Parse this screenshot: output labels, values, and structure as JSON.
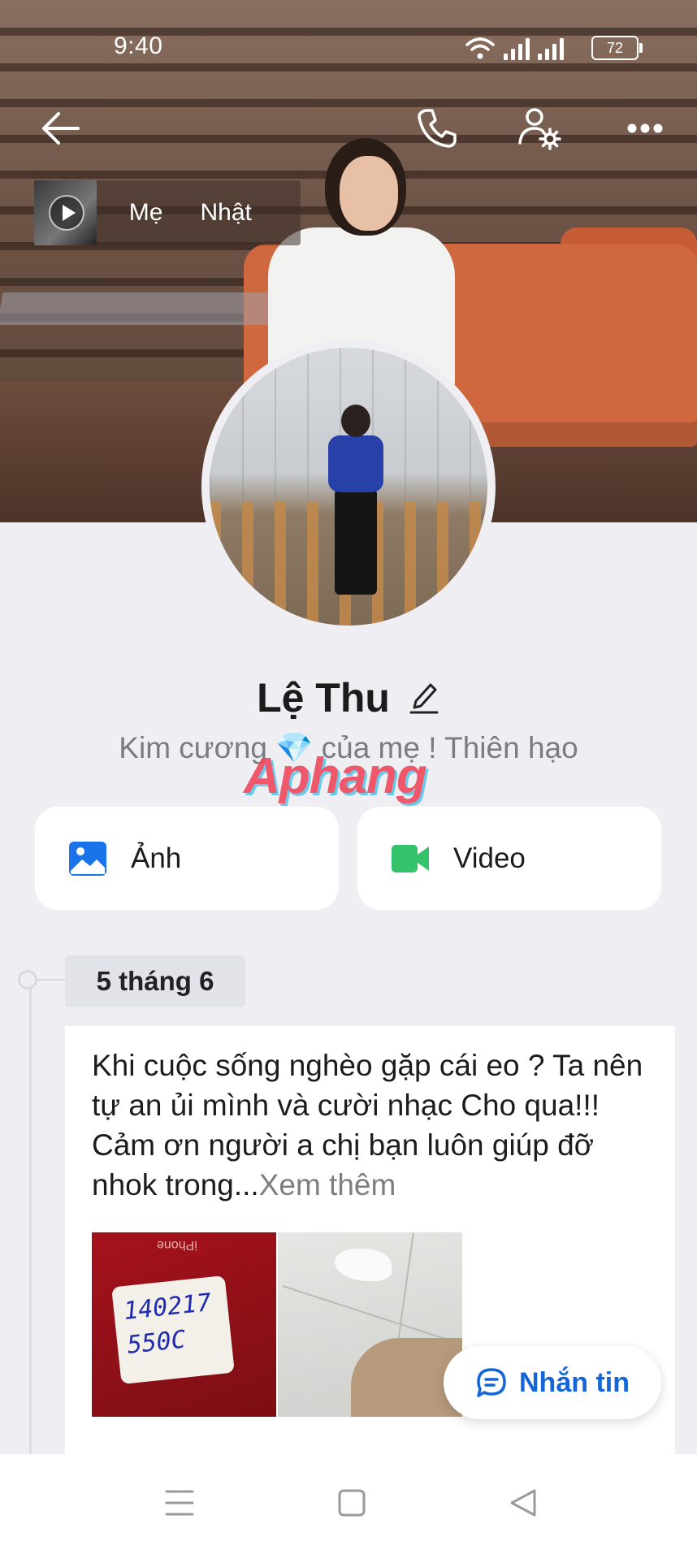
{
  "status_bar": {
    "time": "9:40",
    "battery": "72",
    "icons": [
      "wifi-icon",
      "signal-icon",
      "signal-icon",
      "battery-icon"
    ]
  },
  "header": {
    "icons": [
      "back-arrow-icon",
      "phone-icon",
      "profile-settings-icon",
      "more-dots-icon"
    ]
  },
  "music": {
    "title_parts": [
      "Mẹ",
      "Nhật"
    ],
    "icon": "play-icon"
  },
  "profile": {
    "name": "Lệ Thu",
    "edit_icon": "pencil-icon",
    "bio_left": "Kim cương",
    "bio_emoji": "💎",
    "bio_right": "của mẹ ! Thiên hạo",
    "watermark": "Aphang"
  },
  "media": {
    "photos_label": "Ảnh",
    "videos_label": "Video",
    "photos_icon": "image-icon",
    "videos_icon": "video-camera-icon",
    "colors": {
      "photos": "#1a73e8",
      "videos": "#34c26b"
    }
  },
  "timeline": {
    "date": "5 tháng 6",
    "post_text": "Khi cuộc sống nghèo gặp cái eo ? Ta nên tự an ủi mình và cười nhạc Cho qua!!! Cảm ơn người a chị bạn luôn giúp đỡ nhok trong...",
    "see_more": "Xem thêm",
    "photo1_note": [
      "140217",
      "550C"
    ],
    "photo1_brand": "iPhone"
  },
  "message_button": {
    "label": "Nhắn tin",
    "icon": "chat-bubble-icon",
    "color": "#1466d8"
  },
  "nav": {
    "icons": [
      "menu-icon",
      "home-square-icon",
      "back-triangle-icon"
    ]
  }
}
